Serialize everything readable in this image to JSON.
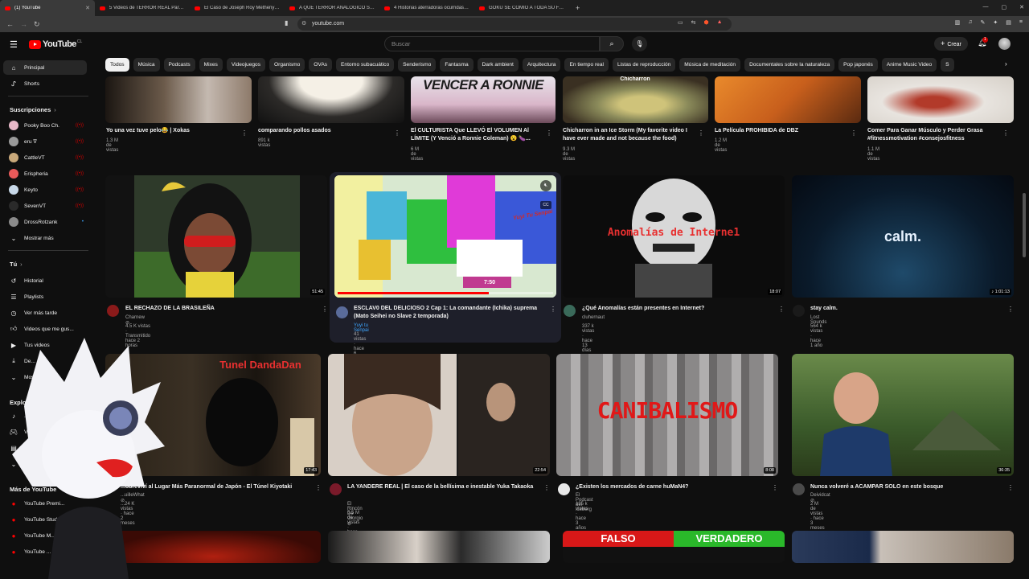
{
  "browser": {
    "tabs": [
      "(1) YouTube",
      "5 Videos de TERROR REAL Para NO D",
      "El Caso de Joseph Roy Metheny | Co",
      "A QUE TERROR ANALOGICO SOBRE",
      "4 Historias aterradoras ocurridas en",
      "GOKU SE COMIÓ A TODA SU FAMILI"
    ],
    "new_tab": "+",
    "url": "youtube.com"
  },
  "header": {
    "logo": "YouTube",
    "country": "CL",
    "search_placeholder": "Buscar",
    "create_label": "Crear",
    "notif_count": "1"
  },
  "chips": [
    "Todos",
    "Música",
    "Podcasts",
    "Mixes",
    "Videojuegos",
    "Organismo",
    "OVAs",
    "Entorno subacuático",
    "Senderismo",
    "Fantasma",
    "Dark ambient",
    "Arquitectura",
    "En tiempo real",
    "Listas de reproducción",
    "Música de meditación",
    "Documentales sobre la naturaleza",
    "Pop japonés",
    "Anime Music Video",
    "S"
  ],
  "sidebar": {
    "principal": "Principal",
    "shorts": "Shorts",
    "subs_title": "Suscripciones",
    "subs": [
      "Pooky Boo Ch.",
      "eru ∇",
      "CattleVT",
      "Erispheria",
      "Keyto",
      "SevenVT",
      "DrossRotzank"
    ],
    "show_more": "Mostrar más",
    "you_title": "Tú",
    "you": [
      "Historial",
      "Playlists",
      "Ver más tarde",
      "Videos que me gus...",
      "Tus videos",
      "De...",
      "Most..."
    ],
    "explore_title": "Explor...",
    "explore": [
      "...",
      "V...",
      "Notic...",
      "Mostrar ma..."
    ],
    "more_title": "Más de YouTube",
    "more": [
      "YouTube Premi...",
      "YouTube Stud...",
      "YouTube M...",
      "YouTube ..."
    ]
  },
  "row1": [
    {
      "title": "Yo una vez tuve pelo😂 | Xokas",
      "meta": "1.3 M de vistas"
    },
    {
      "title": "comparando pollos asados",
      "meta": "891 k vistas"
    },
    {
      "title": "El CULTURISTA Que LLEVÓ El VOLUMEN Al LÍMITE (Y Venció a Ronnie Coleman) 😮 🍆...",
      "meta": "6 M de vistas",
      "thumb_text": "VENCER A RONNIE"
    },
    {
      "title": "Chicharron in an Ice Storm (My favorite video I have ever made and not because the food)",
      "meta": "9.3 M de vistas",
      "thumb_text": "Chicharron"
    },
    {
      "title": "La Película PROHIBIDA de DBZ",
      "meta": "1.2 M de vistas"
    },
    {
      "title": "Comer Para Ganar Músculo y Perder Grasa #fitnessmotivation #consejosfitness",
      "meta": "1.1 M de vistas"
    }
  ],
  "row2": [
    {
      "title": "EL RECHAZO  DE LA BRASILEÑA",
      "channel": "Charnew ⊘",
      "meta": "4.5 K vistas · Transmitido hace 2 horas",
      "duration": "51:45"
    },
    {
      "title": "ESCLAV0 DEL DELICIOSO 2 Cap 1: La comandante (Ichika) suprema (Mato Seihei no Slave 2 temporada)",
      "channel": "Yuyi tu Senpai",
      "meta": "41 vistas · hace 6 horas",
      "time": "7:50",
      "thumb_text": "Yuyi Tu Senpai"
    },
    {
      "title": "¿Qué Anomalías están presentes en Internet?",
      "channel": "cluhernaut",
      "meta": "337 k vistas · hace 13 días",
      "duration": "18:07",
      "thumb_text": "Anomalías de Interne1"
    },
    {
      "title": "stay calm.",
      "channel": "Lost Sounds",
      "meta": "564 k vistas · hace 1 año",
      "duration": "♪ 1:01:13",
      "thumb_text": "calm."
    }
  ],
  "row3": [
    {
      "title": "...obreviví al Lugar Más Paranormal de Japón - El Túnel Kiyotaki",
      "channel": "...uilleWhat ⊘",
      "meta": "...24 K vistas · hace 2 meses",
      "duration": "17:43",
      "thumb_text": "Tunel DandaDan"
    },
    {
      "title": "LA YANDERE REAL | El caso de la bellísima e inestable Yuka Takaoka",
      "channel": "El Rincón De Giorgio ⊘",
      "meta": "5.5 M de vistas · hace 2 años",
      "duration": "22:54"
    },
    {
      "title": "¿Existen los mercados de carne huMaN4?",
      "channel": "El Podcast del Iceberg",
      "meta": "195 k vistas · hace 3 años",
      "duration": "8:08",
      "thumb_text": "CANIBALISMO"
    },
    {
      "title": "Nunca volveré a ACAMPAR SOLO en este bosque",
      "channel": "Deividcat ⊘",
      "meta": "2 M de vistas · hace 3 meses",
      "duration": "36:35"
    }
  ],
  "row4": {
    "falso": "FALSO",
    "verdadero": "VERDADERO"
  },
  "colors": {
    "brand_red": "#ff0000",
    "bg": "#0f0f0f",
    "chip": "#272727"
  }
}
